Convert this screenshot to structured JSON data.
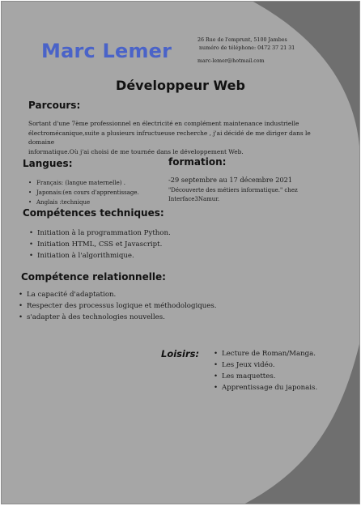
{
  "header": {
    "name": "Marc Lemer",
    "address": "26 Rue de l'emprunt, 5100 Jambes",
    "phone": "numéro de téléphone: 0472 37 21 31",
    "email": "marc-lemer@hotmail.com"
  },
  "job_title": "Développeur Web",
  "parcours": {
    "title": "Parcours:",
    "lines": [
      "Sortant d'une 7ème professionnel en électricité en complément maintenance industrielle",
      "électromécanique,suite a plusieurs infructueuse recherche , j'ai décidé de me diriger dans le domaine",
      "informatique.Où j'ai choisi de me tournée dans le développement Web."
    ]
  },
  "langues": {
    "title": "Langues:",
    "items": [
      "Français: (langue maternelle) .",
      "Japonais:(en cours d'apprentissage.",
      "Anglais :technique"
    ]
  },
  "formation": {
    "title": "formation:",
    "date": "-29 septembre au 17 décembre 2021",
    "desc_lines": [
      "\"Découverte des métiers informatique.\" chez",
      "Interface3Namur."
    ]
  },
  "competences_techniques": {
    "title": "Compétences techniques:",
    "items": [
      "Initiation à la programmation Python.",
      "Initiation HTML, CSS et Javascript.",
      "Initiation à l'algorithmique."
    ]
  },
  "competence_relationnelle": {
    "title": "Compétence relationnelle:",
    "items": [
      "La capacité d'adaptation.",
      "Respecter des processus logique et méthodologiques.",
      "s'adapter à des technologies nouvelles."
    ]
  },
  "loisirs": {
    "title": "Loisirs:",
    "items": [
      "Lecture de Roman/Manga.",
      "Les Jeux vidéo.",
      "Les maquettes.",
      "Apprentissage du japonais."
    ]
  },
  "colors": {
    "page_gray": "#a6a6a6",
    "corner_dark": "#6f6f6f",
    "name_blue": "#4a63c8"
  }
}
